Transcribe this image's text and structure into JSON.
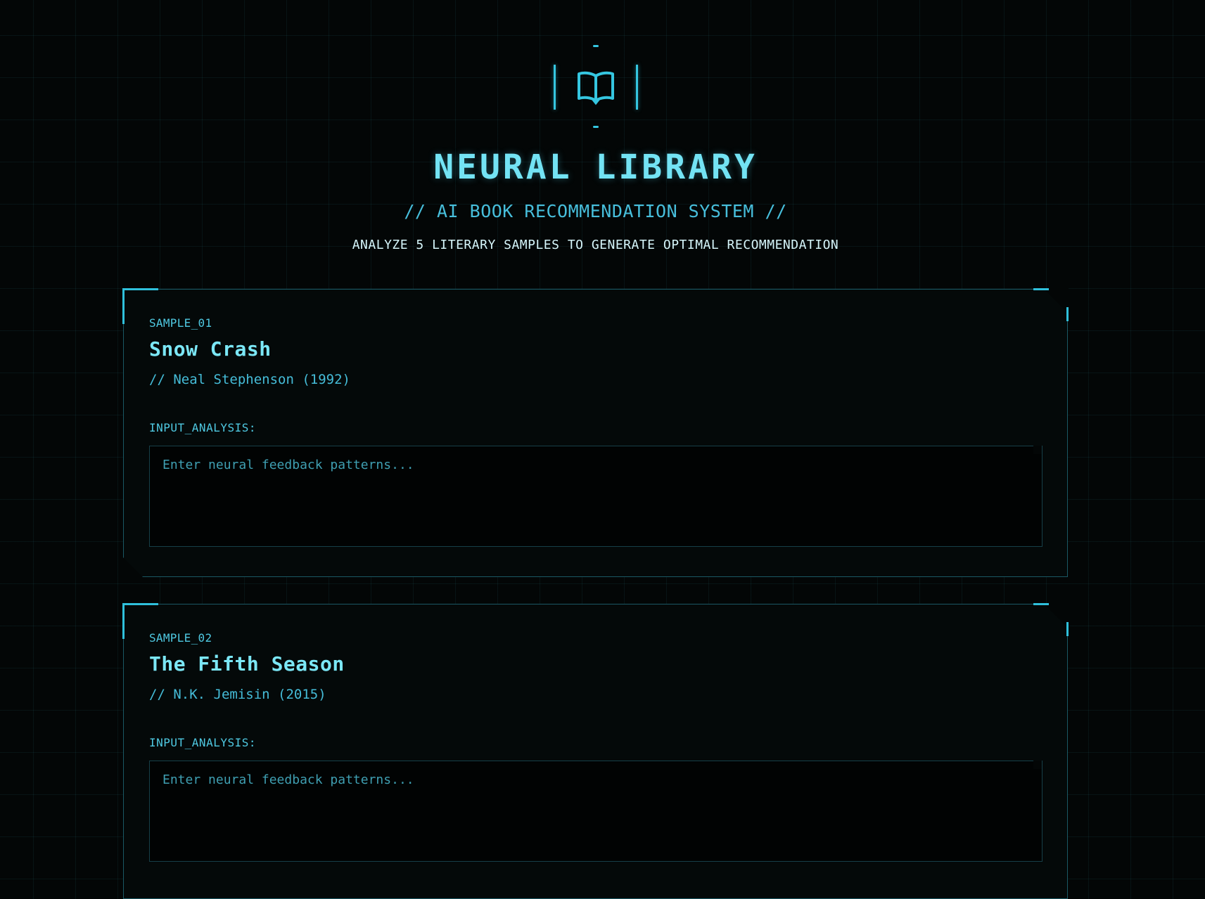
{
  "header": {
    "logo_icon": "open-book-icon",
    "title": "NEURAL LIBRARY",
    "subtitle": "// AI BOOK RECOMMENDATION SYSTEM //",
    "tagline": "ANALYZE 5 LITERARY SAMPLES TO GENERATE OPTIMAL RECOMMENDATION"
  },
  "samples": [
    {
      "label": "SAMPLE_01",
      "title": "Snow Crash",
      "author": "// Neal Stephenson (1992)",
      "field_label": "INPUT_ANALYSIS:",
      "placeholder": "Enter neural feedback patterns...",
      "value": ""
    },
    {
      "label": "SAMPLE_02",
      "title": "The Fifth Season",
      "author": "// N.K. Jemisin (2015)",
      "field_label": "INPUT_ANALYSIS:",
      "placeholder": "Enter neural feedback patterns...",
      "value": ""
    }
  ],
  "colors": {
    "background": "#030606",
    "accent": "#2fc0db",
    "title": "#73e3f4",
    "border": "#1a5864"
  }
}
